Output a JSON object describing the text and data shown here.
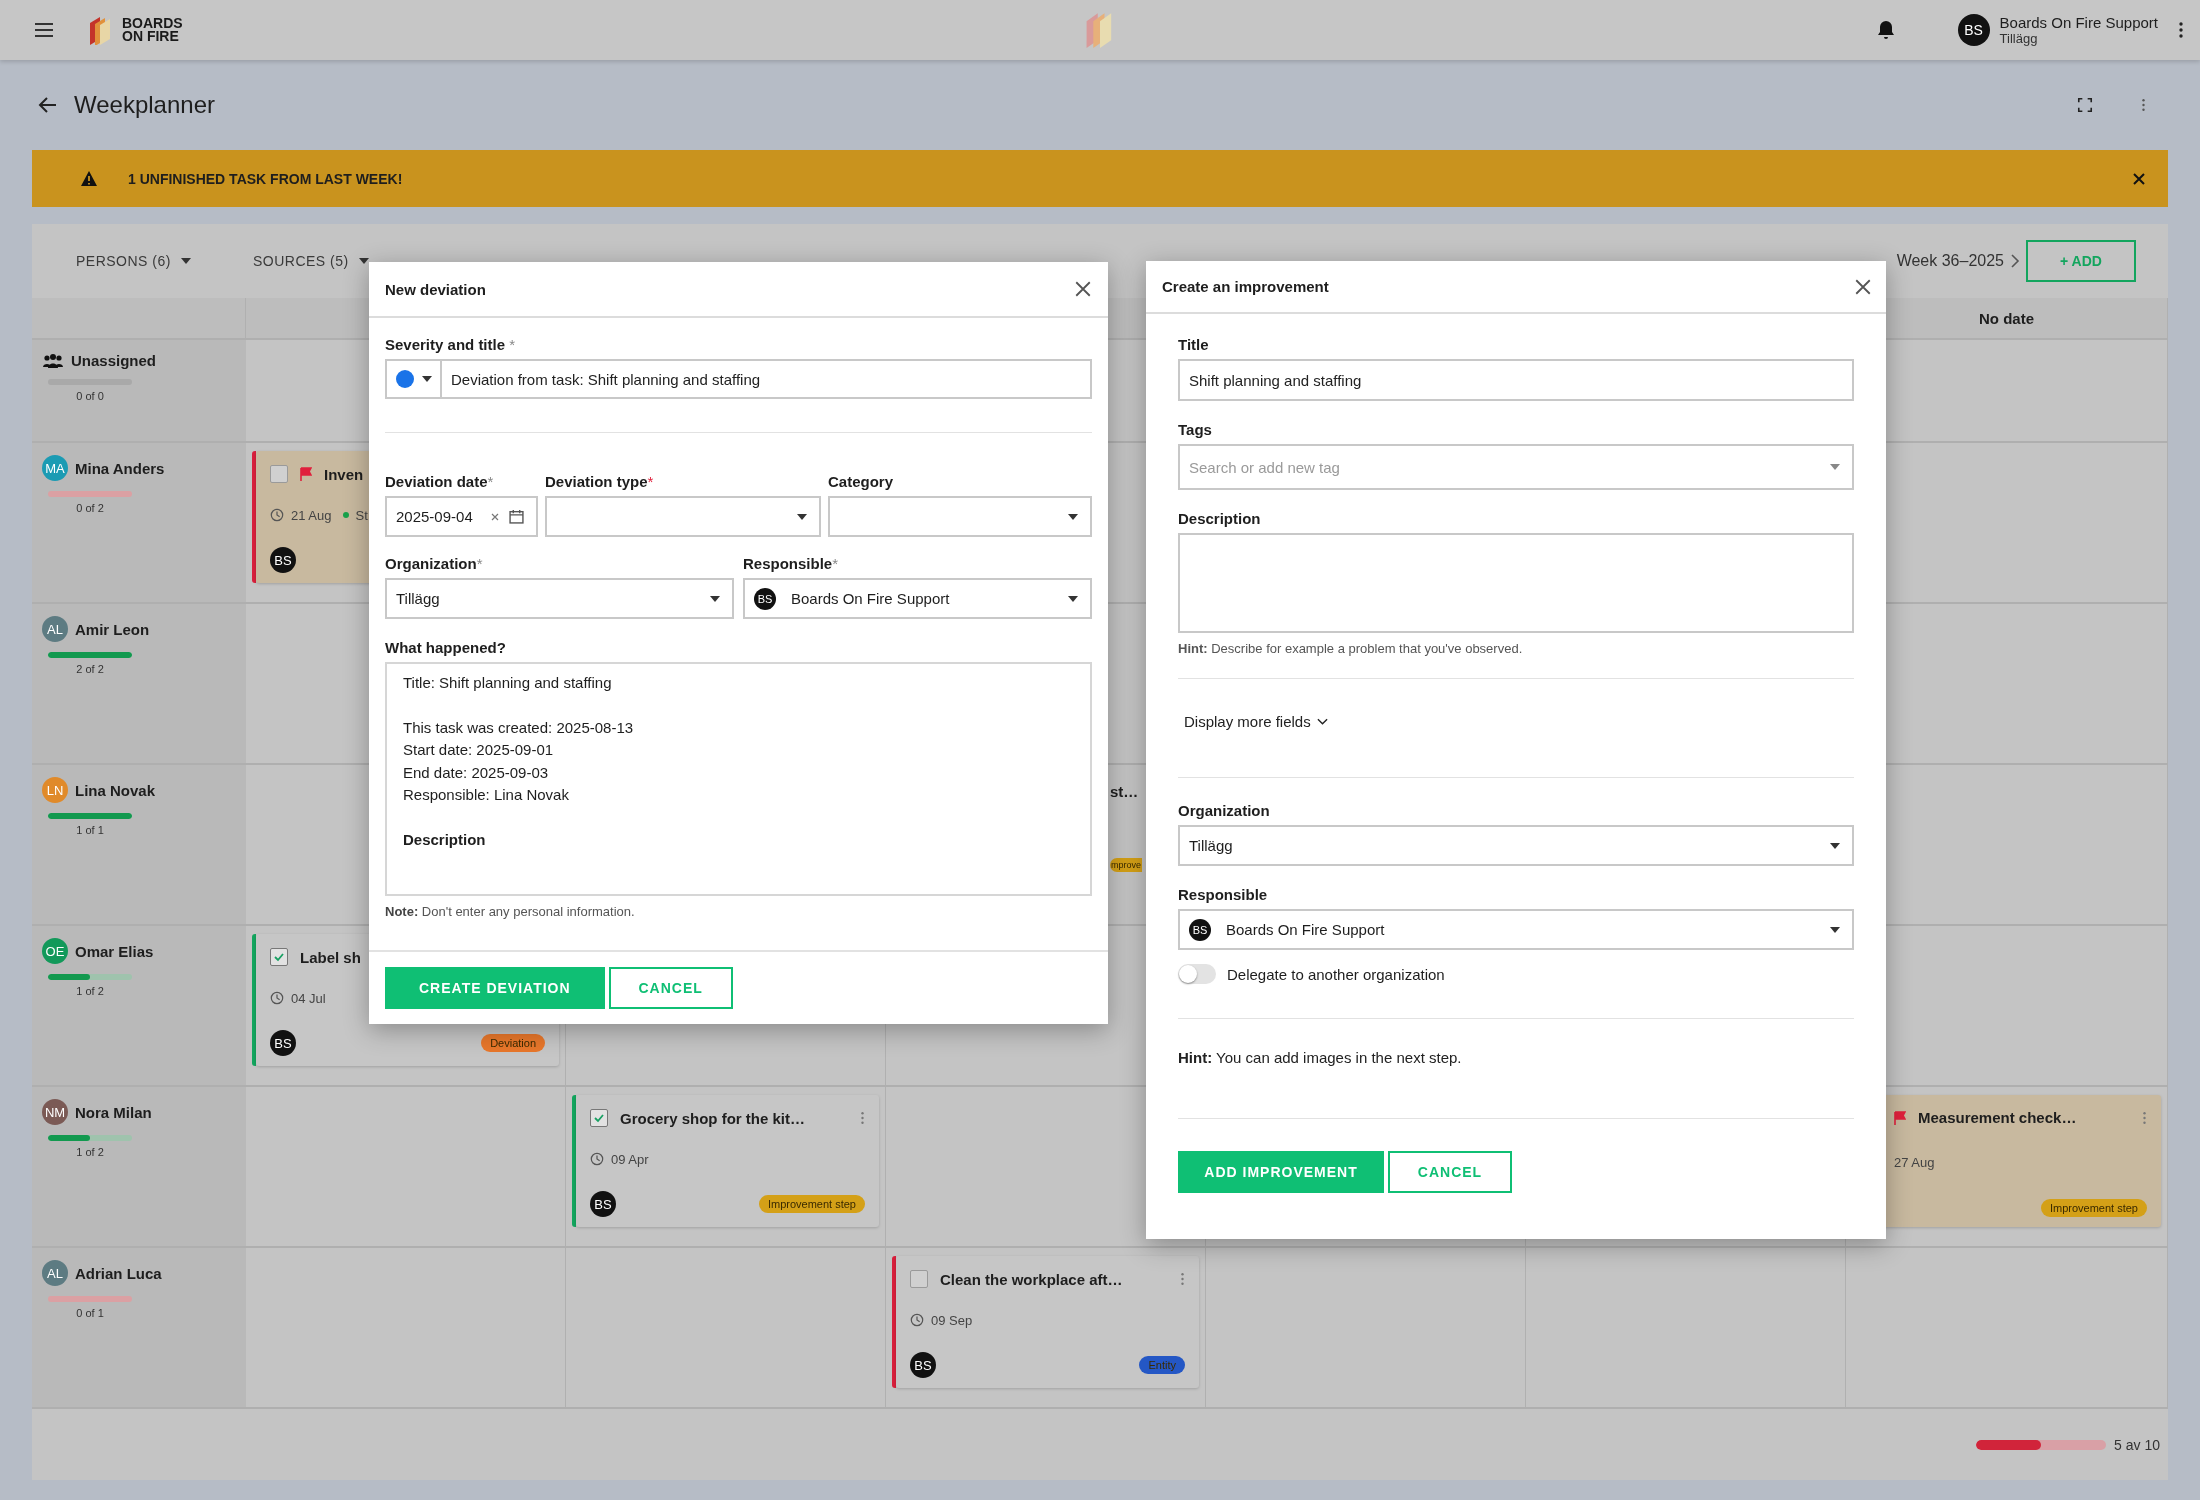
{
  "header": {
    "logo_lines": [
      "BOARDS",
      "ON FIRE"
    ],
    "user": {
      "initials": "BS",
      "name": "Boards On Fire Support",
      "organization": "Tillägg"
    }
  },
  "page": {
    "title": "Weekplanner"
  },
  "banner": {
    "message": "1 UNFINISHED TASK FROM LAST WEEK!"
  },
  "toolbar": {
    "filters": [
      {
        "label": "PERSONS (6)"
      },
      {
        "label": "SOURCES (5)"
      }
    ],
    "week": "Week 36–2025",
    "add_button": "+ ADD"
  },
  "board": {
    "no_date_heading": "No date",
    "rows": [
      {
        "kind": "group",
        "name": "Unassigned",
        "count": "0 of 0",
        "level": 0,
        "cells": [
          {
            "kind": "empty"
          },
          {
            "kind": "empty"
          },
          {
            "kind": "empty"
          },
          {
            "kind": "empty"
          },
          {
            "kind": "empty"
          },
          {
            "kind": "empty"
          }
        ]
      },
      {
        "kind": "person",
        "initials": "MA",
        "color": "#1b9bb3",
        "name": "Mina Anders",
        "count": "0 of 2",
        "level": 0,
        "cells": [
          {
            "kind": "card",
            "title": "Inven",
            "date": "21 Aug",
            "status": "St",
            "checked": false,
            "flagged": true,
            "color": "#d81f3c",
            "avatar": "BS"
          },
          {
            "kind": "empty"
          },
          {
            "kind": "empty"
          },
          {
            "kind": "empty"
          },
          {
            "kind": "empty"
          },
          {
            "kind": "empty"
          }
        ]
      },
      {
        "kind": "person",
        "initials": "AL",
        "color": "#5d7b82",
        "name": "Amir Leon",
        "count": "2 of 2",
        "level": 1,
        "cells": [
          {
            "kind": "empty"
          },
          {
            "kind": "empty"
          },
          {
            "kind": "empty"
          },
          {
            "kind": "empty"
          },
          {
            "kind": "empty"
          },
          {
            "kind": "empty"
          }
        ]
      },
      {
        "kind": "person",
        "initials": "LN",
        "color": "#e08a2a",
        "name": "Lina Novak",
        "count": "1 of 1",
        "level": 1,
        "cells": [
          {
            "kind": "empty"
          },
          {
            "kind": "empty"
          },
          {
            "kind": "fragment",
            "title": "st…",
            "badge": {
              "label": "mprove",
              "color": "#d4a017"
            }
          },
          {
            "kind": "empty"
          },
          {
            "kind": "empty"
          },
          {
            "kind": "empty"
          }
        ]
      },
      {
        "kind": "person",
        "initials": "OE",
        "color": "#12995a",
        "name": "Omar Elias",
        "count": "1 of 2",
        "level": 0.5,
        "cells": [
          {
            "kind": "card",
            "title": "Label sh",
            "date": "04 Jul",
            "checked": true,
            "flagged": false,
            "color": "#13a55e",
            "avatar": "BS",
            "badge": {
              "label": "Deviation",
              "color": "#e8772b"
            }
          },
          {
            "kind": "empty"
          },
          {
            "kind": "empty"
          },
          {
            "kind": "empty"
          },
          {
            "kind": "empty"
          },
          {
            "kind": "empty"
          }
        ]
      },
      {
        "kind": "person",
        "initials": "NM",
        "color": "#7b5a55",
        "name": "Nora Milan",
        "count": "1 of 2",
        "level": 0.5,
        "cells": [
          {
            "kind": "empty"
          },
          {
            "kind": "card",
            "title": "Grocery shop for the kit…",
            "date": "09 Apr",
            "checked": true,
            "flagged": false,
            "color": "#13a55e",
            "avatar": "BS",
            "menu": true,
            "badge": {
              "label": "Improvement step",
              "color": "#d4a017"
            }
          },
          {
            "kind": "empty"
          },
          {
            "kind": "empty"
          },
          {
            "kind": "empty"
          },
          {
            "kind": "covered",
            "title": "Measurement check…",
            "date": "27 Aug",
            "flagged": true,
            "menu": true,
            "badge": {
              "label": "Improvement step",
              "color": "#d4a017"
            }
          }
        ]
      },
      {
        "kind": "person",
        "initials": "AL",
        "color": "#5d7b82",
        "name": "Adrian Luca",
        "count": "0 of 1",
        "level": 0,
        "cells": [
          {
            "kind": "empty"
          },
          {
            "kind": "empty"
          },
          {
            "kind": "card",
            "title": "Clean the workplace aft…",
            "date": "09 Sep",
            "checked": false,
            "flagged": false,
            "color": "#d81f3c",
            "avatar": "BS",
            "menu": true,
            "badge": {
              "label": "Entity",
              "color": "#2457c5"
            }
          },
          {
            "kind": "empty"
          },
          {
            "kind": "empty"
          },
          {
            "kind": "empty"
          }
        ]
      }
    ],
    "footer": {
      "count": "5 av 10",
      "level": 0.5
    }
  },
  "deviation_dialog": {
    "title": "New deviation",
    "severity_label": "Severity and title",
    "severity_mark": "*",
    "severity": {
      "color": "#1a73e8"
    },
    "title_value": "Deviation from task: Shift planning and staffing",
    "fields": [
      {
        "kind": "date",
        "label": "Deviation date",
        "mark": "*",
        "alert": false,
        "value": "2025-09-04"
      },
      {
        "kind": "select",
        "label": "Deviation type",
        "mark": "*",
        "alert": true
      },
      {
        "kind": "select",
        "label": "Category"
      }
    ],
    "fields_2": [
      {
        "kind": "select",
        "label": "Organization",
        "mark": "*",
        "alert": false,
        "value": "Tillägg"
      },
      {
        "kind": "person",
        "label": "Responsible",
        "mark": "*",
        "alert": false,
        "initials": "BS",
        "value": "Boards On Fire Support"
      }
    ],
    "what_label": "What happened?",
    "what_paragraphs": [
      {
        "bold": false,
        "lines": [
          "Title: Shift planning and staffing"
        ]
      },
      {
        "bold": false,
        "lines": [
          "This task was created: 2025-08-13",
          "Start date: 2025-09-01",
          "End date: 2025-09-03",
          "Responsible: Lina Novak"
        ]
      },
      {
        "bold": true,
        "lines": [
          "Description"
        ]
      }
    ],
    "note": "**Note:** Don't enter any personal information.",
    "submit": "CREATE DEVIATION",
    "cancel": "CANCEL"
  },
  "improvement_dialog": {
    "title": "Create an improvement",
    "title_label": "Title",
    "title_value": "Shift planning and staffing",
    "tags_label": "Tags",
    "tags_placeholder": "Search or add new tag",
    "description_label": "Description",
    "description_hint": "**Hint:** Describe for example a problem that you've observed.",
    "more_fields": "Display more fields",
    "organization_label": "Organization",
    "organization_value": "Tillägg",
    "responsible_label": "Responsible",
    "responsible_initials": "BS",
    "responsible_value": "Boards On Fire Support",
    "delegate": {
      "label": "Delegate to another organization",
      "on": false
    },
    "images_hint": "**Hint:** You can add images in the next step.",
    "submit": "ADD IMPROVEMENT",
    "cancel": "CANCEL"
  }
}
